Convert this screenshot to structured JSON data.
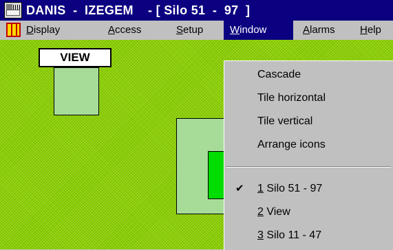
{
  "titlebar": {
    "title": "DANIS  -  IZEGEM    - [ Silo 51  -  97  ]"
  },
  "menubar": {
    "items": [
      {
        "mnemonic": "D",
        "rest": "isplay"
      },
      {
        "mnemonic": "A",
        "rest": "ccess"
      },
      {
        "mnemonic": "S",
        "rest": "etup"
      },
      {
        "mnemonic": "W",
        "rest": "indow"
      },
      {
        "mnemonic": "A",
        "rest": "larms"
      },
      {
        "mnemonic": "H",
        "rest": "elp"
      }
    ]
  },
  "client": {
    "view_label": "VIEW"
  },
  "window_menu": {
    "items": [
      {
        "label": "Cascade"
      },
      {
        "label": "Tile horizontal"
      },
      {
        "label": "Tile vertical"
      },
      {
        "label": "Arrange icons"
      }
    ],
    "windows": [
      {
        "num": "1",
        "label": " Silo 51  -  97",
        "checked": true
      },
      {
        "num": "2",
        "label": "  View",
        "checked": false
      },
      {
        "num": "3",
        "label": " Silo 11  -  47",
        "checked": false
      }
    ]
  },
  "colors": {
    "titlebar": "#0b0080",
    "menu_face": "#c0c0c0",
    "field_green": "#88d000",
    "box_green": "#a6dc98",
    "active_green": "#00dd00"
  }
}
